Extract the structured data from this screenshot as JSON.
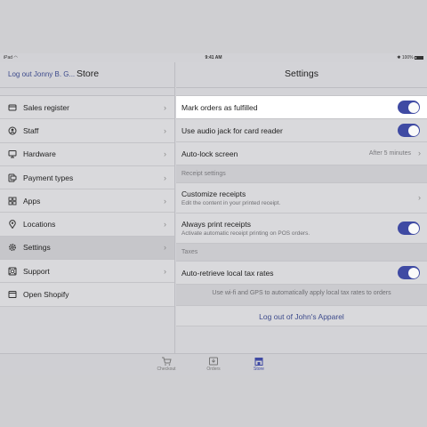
{
  "status_bar": {
    "device": "iPad",
    "time": "9:41 AM",
    "battery": "100%"
  },
  "left_header": {
    "logout_link": "Log out Jonny B. G...",
    "title": "Store"
  },
  "menu": [
    {
      "label": "Sales register",
      "icon": "sales-register-icon",
      "chevron": true
    },
    {
      "label": "Staff",
      "icon": "staff-icon",
      "chevron": true
    },
    {
      "label": "Hardware",
      "icon": "hardware-icon",
      "chevron": true
    },
    {
      "label": "Payment types",
      "icon": "payment-types-icon",
      "chevron": true
    },
    {
      "label": "Apps",
      "icon": "apps-icon",
      "chevron": true
    },
    {
      "label": "Locations",
      "icon": "locations-icon",
      "chevron": true
    },
    {
      "label": "Settings",
      "icon": "settings-icon",
      "chevron": true,
      "active": true
    },
    {
      "label": "Support",
      "icon": "support-icon",
      "chevron": true
    },
    {
      "label": "Open Shopify",
      "icon": "open-shopify-icon",
      "chevron": false
    }
  ],
  "settings": {
    "title": "Settings",
    "general": {
      "mark_orders": {
        "label": "Mark orders as fulfilled",
        "enabled": true
      },
      "audio_jack": {
        "label": "Use audio jack for card reader",
        "enabled": true
      },
      "auto_lock": {
        "label": "Auto-lock screen",
        "value": "After 5 minutes"
      }
    },
    "receipt_header": "Receipt settings",
    "receipts": {
      "customize": {
        "label": "Customize receipts",
        "sub": "Edit the content in your printed receipt."
      },
      "always_print": {
        "label": "Always print receipts",
        "sub": "Activate automatic receipt printing on POS orders.",
        "enabled": true
      }
    },
    "taxes_header": "Taxes",
    "taxes": {
      "auto_retrieve": {
        "label": "Auto-retrieve local tax rates",
        "enabled": true
      },
      "footnote": "Use wi-fi and GPS to automatically apply local tax rates to orders"
    },
    "logout_store": "Log out of John's Apparel"
  },
  "tabs": [
    {
      "label": "Checkout",
      "icon": "checkout-icon",
      "active": false
    },
    {
      "label": "Orders",
      "icon": "orders-icon",
      "active": false
    },
    {
      "label": "Store",
      "icon": "store-icon",
      "active": true
    }
  ],
  "colors": {
    "accent": "#3f4aa3",
    "link": "#3d4b8c",
    "highlight": "#ffffff"
  }
}
